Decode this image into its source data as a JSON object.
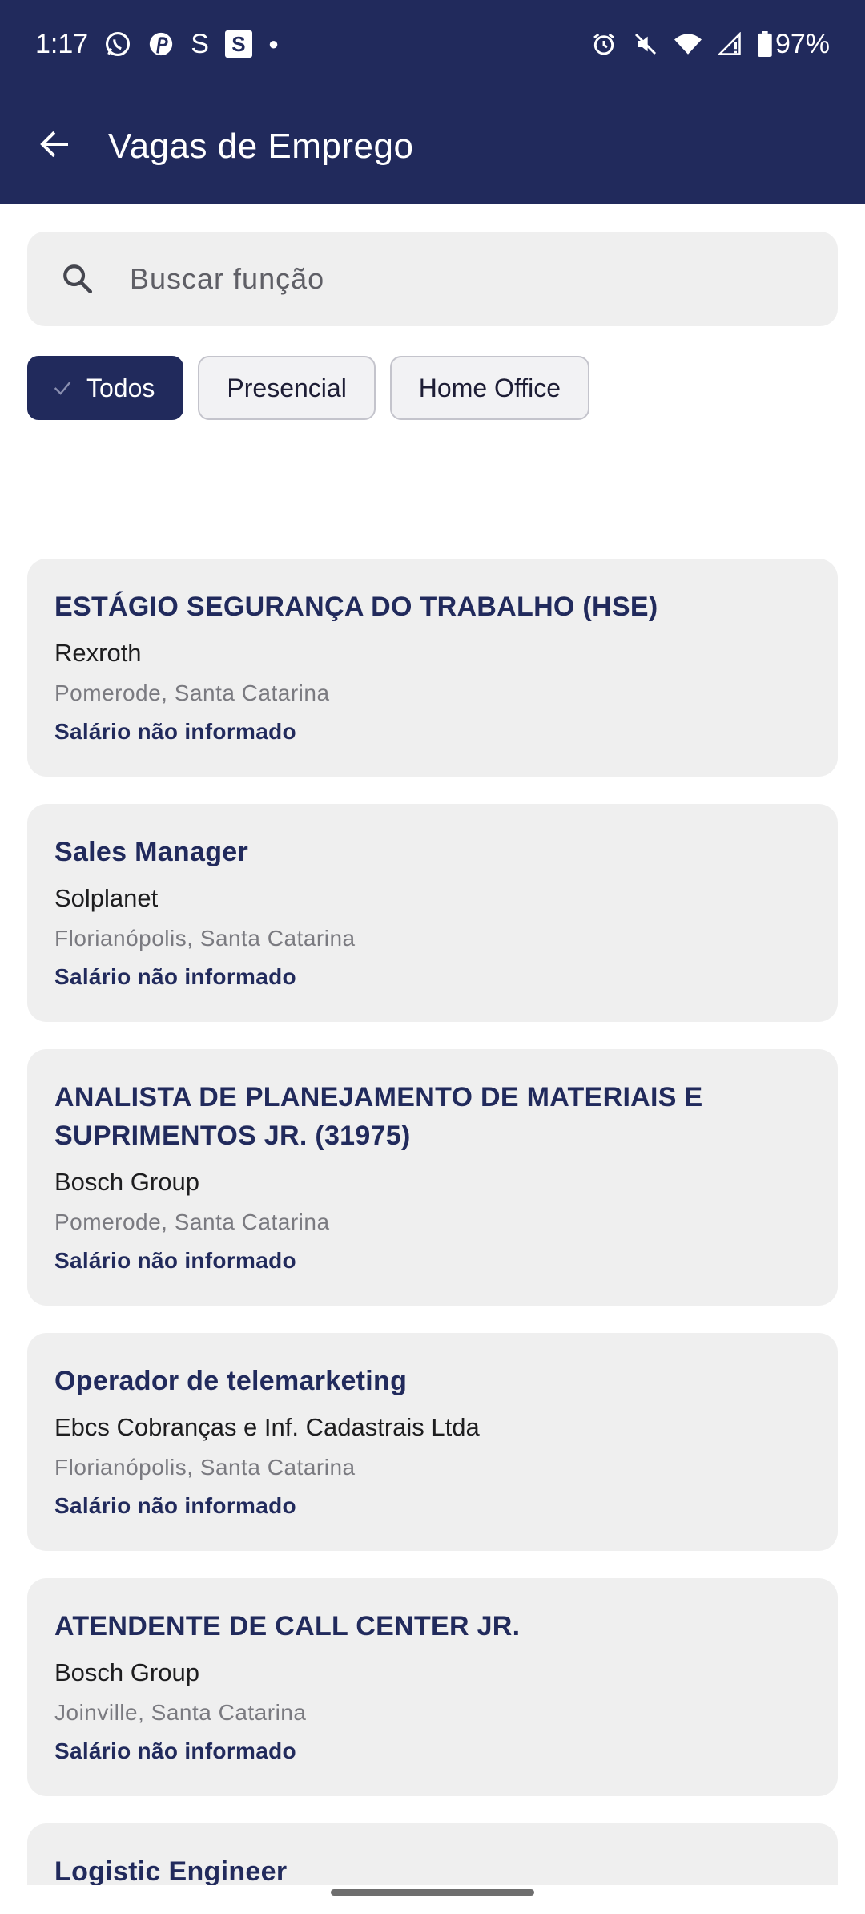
{
  "status_bar": {
    "time": "1:17",
    "battery": "97%",
    "left_icons": [
      "whatsapp-icon",
      "pinterest-icon",
      "s-app-icon",
      "s-box-icon",
      "dot-icon"
    ],
    "right_icons": [
      "alarm-icon",
      "vibrate-off-icon",
      "wifi-icon",
      "signal-icon",
      "battery-icon"
    ],
    "s_app_glyph": "S",
    "s_box_glyph": "S"
  },
  "header": {
    "title": "Vagas de Emprego",
    "background": "#212a5c"
  },
  "search": {
    "placeholder": "Buscar função",
    "value": ""
  },
  "filters": {
    "chips": [
      {
        "label": "Todos",
        "selected": true
      },
      {
        "label": "Presencial",
        "selected": false
      },
      {
        "label": "Home Office",
        "selected": false
      }
    ]
  },
  "jobs": [
    {
      "title": "ESTÁGIO SEGURANÇA DO TRABALHO (HSE)",
      "company": "Rexroth",
      "location": "Pomerode, Santa Catarina",
      "salary": "Salário não informado"
    },
    {
      "title": "Sales Manager",
      "company": "Solplanet",
      "location": "Florianópolis, Santa Catarina",
      "salary": "Salário não informado"
    },
    {
      "title": "ANALISTA DE PLANEJAMENTO DE MATERIAIS E SUPRIMENTOS JR. (31975)",
      "company": "Bosch Group",
      "location": "Pomerode, Santa Catarina",
      "salary": "Salário não informado"
    },
    {
      "title": "Operador de telemarketing",
      "company": "Ebcs Cobranças e Inf. Cadastrais Ltda",
      "location": "Florianópolis, Santa Catarina",
      "salary": "Salário não informado"
    },
    {
      "title": "ATENDENTE DE CALL CENTER JR.",
      "company": "Bosch Group",
      "location": "Joinville, Santa Catarina",
      "salary": "Salário não informado"
    },
    {
      "title": "Logistic Engineer",
      "company": "",
      "location": "",
      "salary": ""
    }
  ],
  "colors": {
    "primary": "#212a5c",
    "card_background": "#efefef",
    "secondary_text": "#7a7a80"
  }
}
